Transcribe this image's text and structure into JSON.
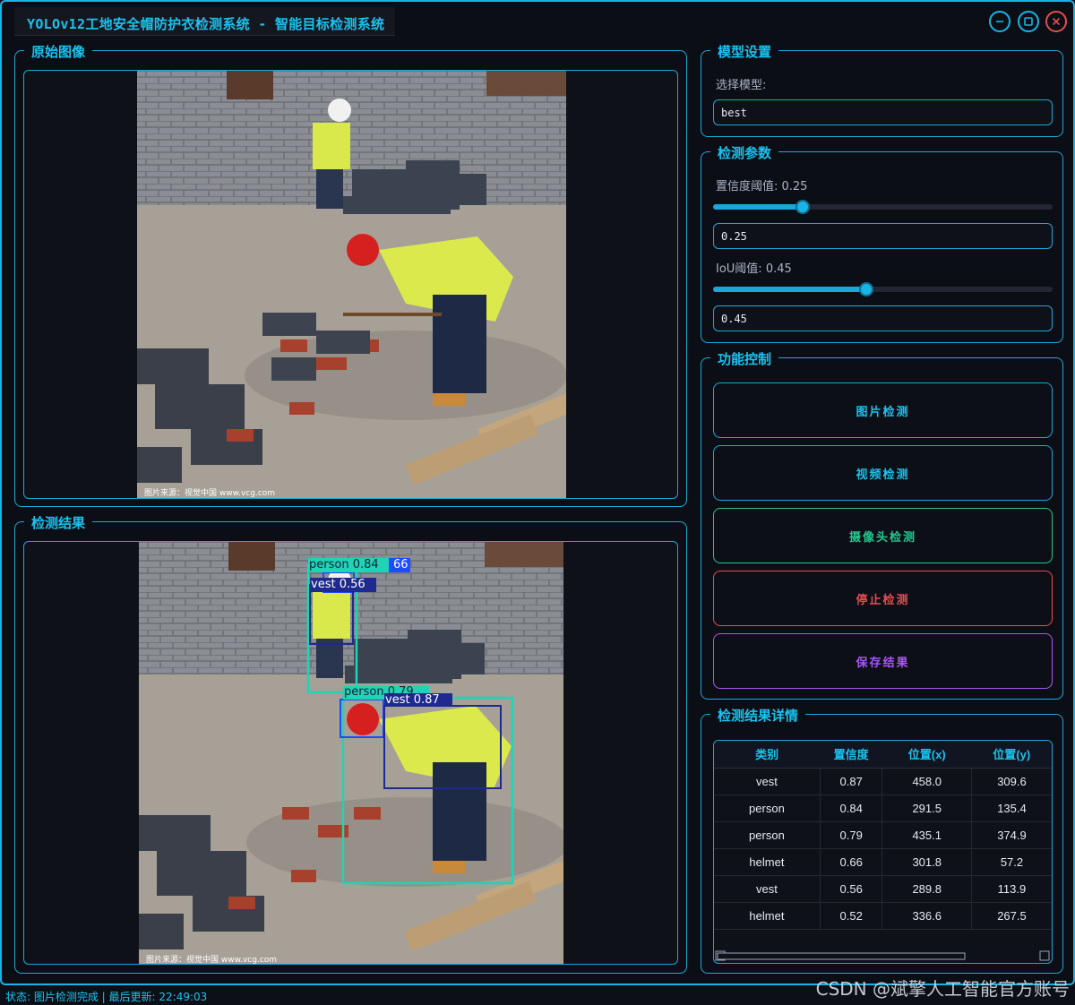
{
  "window": {
    "title": "YOLOv12工地安全帽防护衣检测系统 - 智能目标检测系统"
  },
  "panels": {
    "original": {
      "title": "原始图像",
      "photo_credit": "图片来源：视觉中国 www.vcg.com"
    },
    "result": {
      "title": "检测结果",
      "photo_credit": "图片来源：视觉中国 www.vcg.com"
    }
  },
  "detection_overlays": [
    {
      "label": "person  0.84",
      "suffix": "66"
    },
    {
      "label": "vest  0.56",
      "prefix": ""
    },
    {
      "label": "person  0.79"
    },
    {
      "label": "vest  0.87"
    }
  ],
  "model_settings": {
    "title": "模型设置",
    "select_label": "选择模型:",
    "selected_model": "best"
  },
  "params": {
    "title": "检测参数",
    "conf_label": "置信度阈值: 0.25",
    "conf_value": "0.25",
    "conf_level": 0.25,
    "iou_label": "IoU阈值: 0.45",
    "iou_value": "0.45",
    "iou_level": 0.45
  },
  "controls": {
    "title": "功能控制",
    "image_detect": "图片检测",
    "video_detect": "视频检测",
    "camera_detect": "摄像头检测",
    "stop_detect": "停止检测",
    "save_results": "保存结果"
  },
  "results": {
    "title": "检测结果详情",
    "columns": [
      "类别",
      "置信度",
      "位置(x)",
      "位置(y)"
    ],
    "rows": [
      [
        "vest",
        "0.87",
        "458.0",
        "309.6"
      ],
      [
        "person",
        "0.84",
        "291.5",
        "135.4"
      ],
      [
        "person",
        "0.79",
        "435.1",
        "374.9"
      ],
      [
        "helmet",
        "0.66",
        "301.8",
        "57.2"
      ],
      [
        "vest",
        "0.56",
        "289.8",
        "113.9"
      ],
      [
        "helmet",
        "0.52",
        "336.6",
        "267.5"
      ]
    ]
  },
  "status_bar": {
    "text": "状态: 图片检测完成 | 最后更新: 22:49:03"
  },
  "watermark": "CSDN @斌擎人工智能官方账号",
  "colors": {
    "accent": "#19c3f0",
    "camera": "#22c98f",
    "stop": "#e64d4d",
    "save": "#a855f7"
  }
}
